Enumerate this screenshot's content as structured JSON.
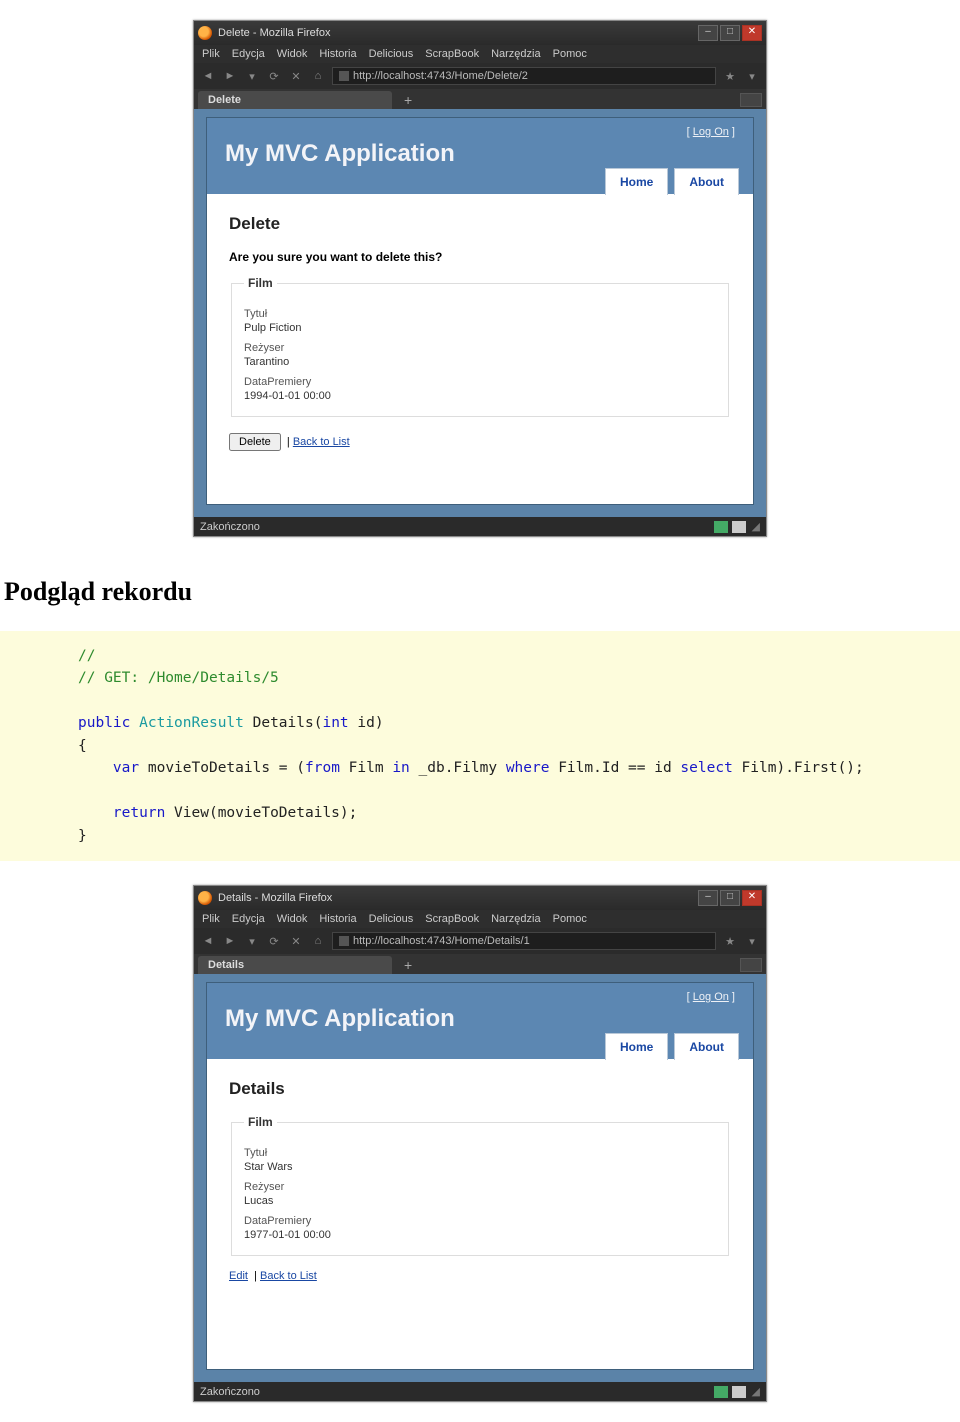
{
  "section_heading": "Podgląd rekordu",
  "menubar": [
    "Plik",
    "Edycja",
    "Widok",
    "Historia",
    "Delicious",
    "ScrapBook",
    "Narzędzia",
    "Pomoc"
  ],
  "app": {
    "title": "My MVC Application",
    "logon_label": "Log On",
    "nav_home": "Home",
    "nav_about": "About"
  },
  "browser1": {
    "window_title": "Delete - Mozilla Firefox",
    "tab_title": "Delete",
    "url": "http://localhost:4743/Home/Delete/2",
    "status": "Zakończono",
    "page": {
      "heading": "Delete",
      "confirm": "Are you sure you want to delete this?",
      "legend": "Film",
      "fields": {
        "f1_label": "Tytuł",
        "f1_value": "Pulp Fiction",
        "f2_label": "Reżyser",
        "f2_value": "Tarantino",
        "f3_label": "DataPremiery",
        "f3_value": "1994-01-01 00:00"
      },
      "delete_btn": "Delete",
      "back_link": "Back to List"
    }
  },
  "browser2": {
    "window_title": "Details - Mozilla Firefox",
    "tab_title": "Details",
    "url": "http://localhost:4743/Home/Details/1",
    "status": "Zakończono",
    "page": {
      "heading": "Details",
      "legend": "Film",
      "fields": {
        "f1_label": "Tytuł",
        "f1_value": "Star Wars",
        "f2_label": "Reżyser",
        "f2_value": "Lucas",
        "f3_label": "DataPremiery",
        "f3_value": "1977-01-01 00:00"
      },
      "edit_link": "Edit",
      "back_link": "Back to List"
    }
  },
  "code": {
    "c1": "//",
    "c2": "// GET: /Home/Details/5",
    "kw_public": "public",
    "type_ar": "ActionResult",
    "m_name": " Details(",
    "kw_int": "int",
    "m_tail": " id)",
    "brace_o": "{",
    "kw_var": "var",
    "ln_a": " movieToDetails = (",
    "kw_from": "from",
    "ln_b": " Film ",
    "kw_in": "in",
    "ln_c": " _db.Filmy ",
    "kw_where": "where",
    "ln_d": " Film.Id == id ",
    "kw_select": "select",
    "ln_e": " Film).First();",
    "kw_return": "return",
    "ln_ret": " View(movieToDetails);",
    "brace_c": "}"
  }
}
